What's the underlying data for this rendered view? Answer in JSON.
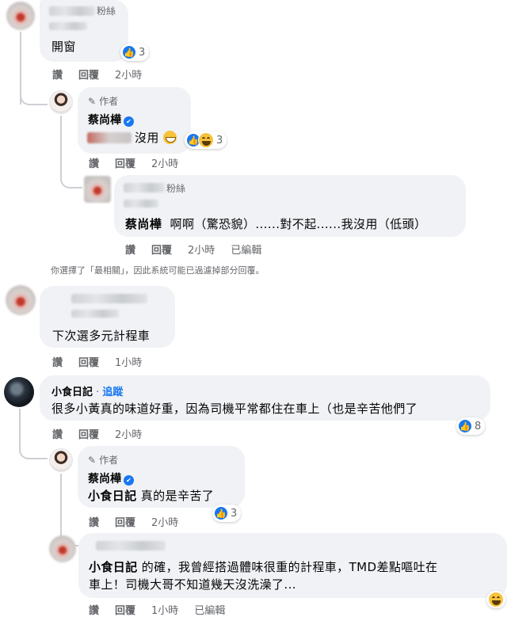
{
  "actions": {
    "like": "讚",
    "reply": "回覆",
    "edited": "已編輯"
  },
  "comments": [
    {
      "name_suffix": "粉絲",
      "text": "開窗",
      "reactions": {
        "count": "3",
        "icons": [
          "like-icon"
        ]
      },
      "time": "2小時"
    },
    {
      "author_badge": "作者",
      "name": "蔡尚樺",
      "text": "沒用",
      "reactions": {
        "count": "3",
        "icons": [
          "like-icon",
          "haha-icon"
        ]
      },
      "time": "2小時"
    },
    {
      "name_suffix": "粉絲",
      "mention": "蔡尚樺",
      "text": "啊啊（驚恐貌）......對不起......我沒用（低頭）",
      "time": "2小時"
    },
    {
      "text": "下次選多元計程車",
      "time": "1小時"
    },
    {
      "name": "小食日記",
      "follow_label": "追蹤",
      "text": "很多小黃真的味道好重，因為司機平常都住在車上（也是辛苦他們了",
      "reactions": {
        "count": "8",
        "icons": [
          "like-icon"
        ]
      },
      "time": "2小時"
    },
    {
      "author_badge": "作者",
      "name": "蔡尚樺",
      "mention": "小食日記",
      "text": "真的是辛苦了",
      "reactions": {
        "count": "3",
        "icons": [
          "like-icon"
        ]
      },
      "time": "2小時"
    },
    {
      "mention": "小食日記",
      "text_line1": "的確，我曾經搭過體味很重的計程車，TMD差點嘔吐在",
      "text_line2": "車上！司機大哥不知道幾天沒洗澡了...",
      "reactions": {
        "icons": [
          "haha-icon"
        ]
      },
      "time": "1小時"
    }
  ],
  "filter_notice": "你選擇了「最相關」，因此系統可能已過濾掉部分回覆。",
  "colors": {
    "like_blue": "#1877f2",
    "bubble_gray": "#f0f2f5",
    "meta_gray": "#65676b"
  }
}
